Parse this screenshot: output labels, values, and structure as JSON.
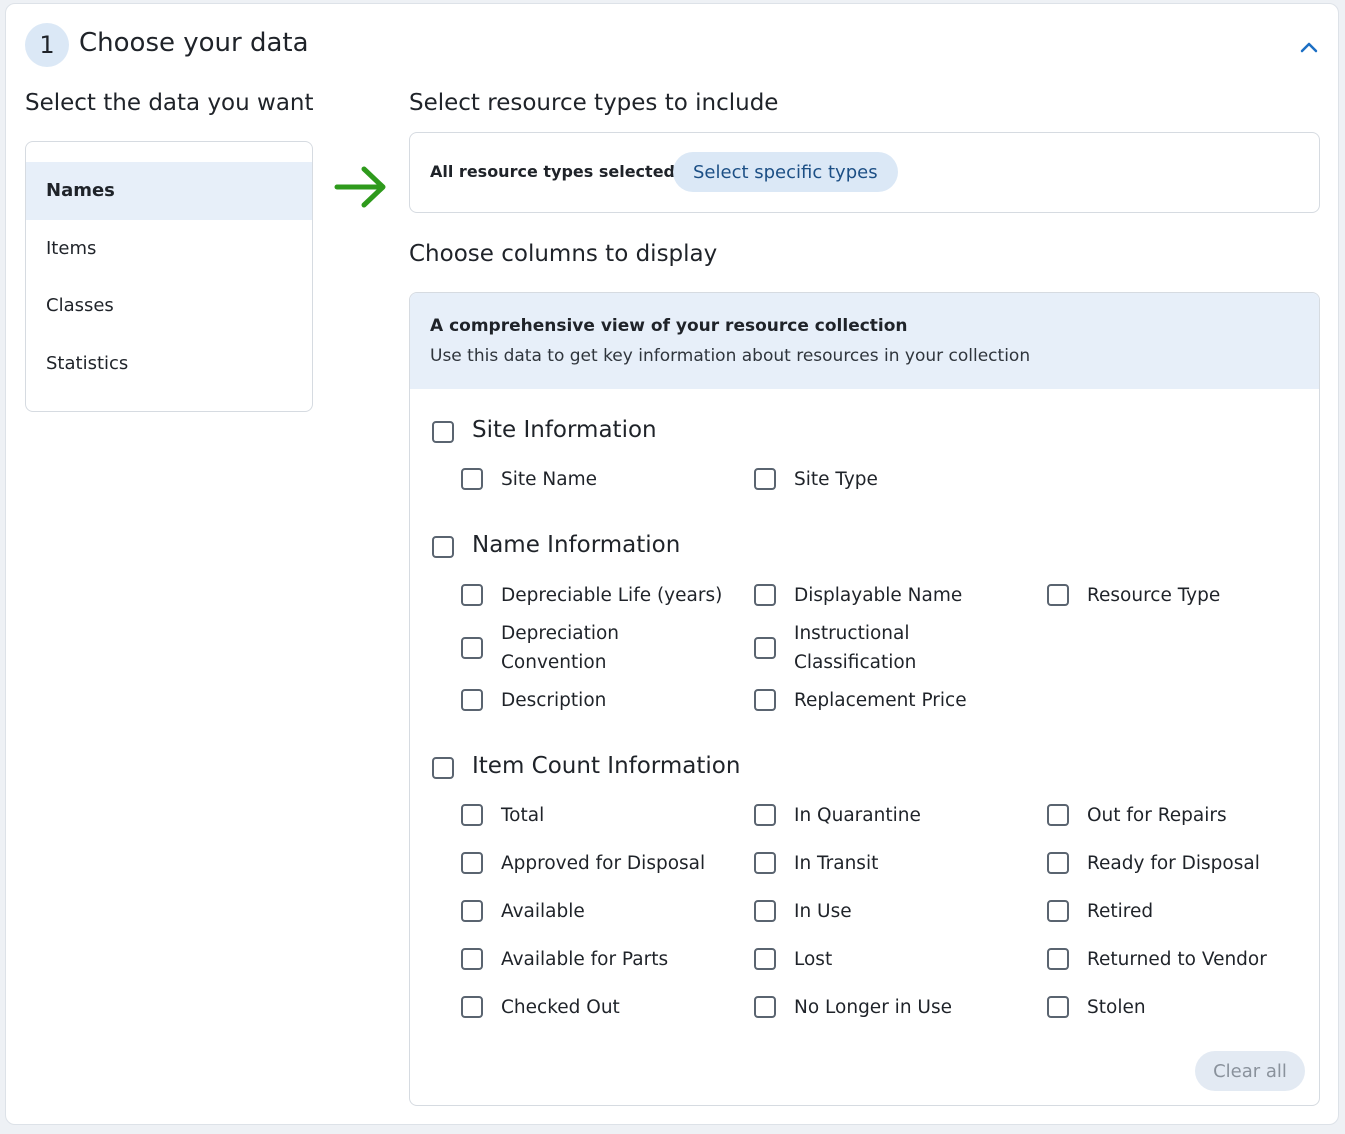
{
  "step": {
    "number": "1",
    "title": "Choose your data"
  },
  "left": {
    "heading": "Select the data you want",
    "items": [
      {
        "label": "Names",
        "active": true
      },
      {
        "label": "Items",
        "active": false
      },
      {
        "label": "Classes",
        "active": false
      },
      {
        "label": "Statistics",
        "active": false
      }
    ]
  },
  "resource_types": {
    "heading": "Select resource types to include",
    "status": "All resource types selected",
    "button": "Select specific types"
  },
  "columns": {
    "heading": "Choose columns to display",
    "banner_title": "A comprehensive view of your resource collection",
    "banner_subtitle": "Use this data to get key information about resources in your collection",
    "groups": [
      {
        "label": "Site Information",
        "items": [
          {
            "line1": "Site Name",
            "line2": ""
          },
          {
            "line1": "Site Type",
            "line2": ""
          }
        ]
      },
      {
        "label": "Name Information",
        "items": [
          {
            "line1": "Depreciable Life (years)",
            "line2": ""
          },
          {
            "line1": "Displayable Name",
            "line2": ""
          },
          {
            "line1": "Resource Type",
            "line2": ""
          },
          {
            "line1": "Depreciation",
            "line2": "Convention"
          },
          {
            "line1": "Instructional",
            "line2": "Classification"
          },
          {
            "line1": "Description",
            "line2": ""
          },
          {
            "line1": "Replacement Price",
            "line2": ""
          }
        ]
      },
      {
        "label": "Item Count Information",
        "items": [
          {
            "line1": "Total",
            "line2": ""
          },
          {
            "line1": "In Quarantine",
            "line2": ""
          },
          {
            "line1": "Out for Repairs",
            "line2": ""
          },
          {
            "line1": "Approved for Disposal",
            "line2": ""
          },
          {
            "line1": "In Transit",
            "line2": ""
          },
          {
            "line1": "Ready for Disposal",
            "line2": ""
          },
          {
            "line1": "Available",
            "line2": ""
          },
          {
            "line1": "In Use",
            "line2": ""
          },
          {
            "line1": "Retired",
            "line2": ""
          },
          {
            "line1": "Available for Parts",
            "line2": ""
          },
          {
            "line1": "Lost",
            "line2": ""
          },
          {
            "line1": "Returned to Vendor",
            "line2": ""
          },
          {
            "line1": "Checked Out",
            "line2": ""
          },
          {
            "line1": "No Longer in Use",
            "line2": ""
          },
          {
            "line1": "Stolen",
            "line2": ""
          }
        ]
      }
    ],
    "clear_button": "Clear all"
  },
  "icons": {
    "collapse": "chevron-up-icon",
    "arrow": "arrow-right-icon",
    "checkbox": "checkbox-unchecked"
  },
  "colors": {
    "accent": "#1c6fc4",
    "arrow": "#2e9a1c",
    "active_bg": "#e7eff9",
    "badge_bg": "#dbe8f6"
  }
}
